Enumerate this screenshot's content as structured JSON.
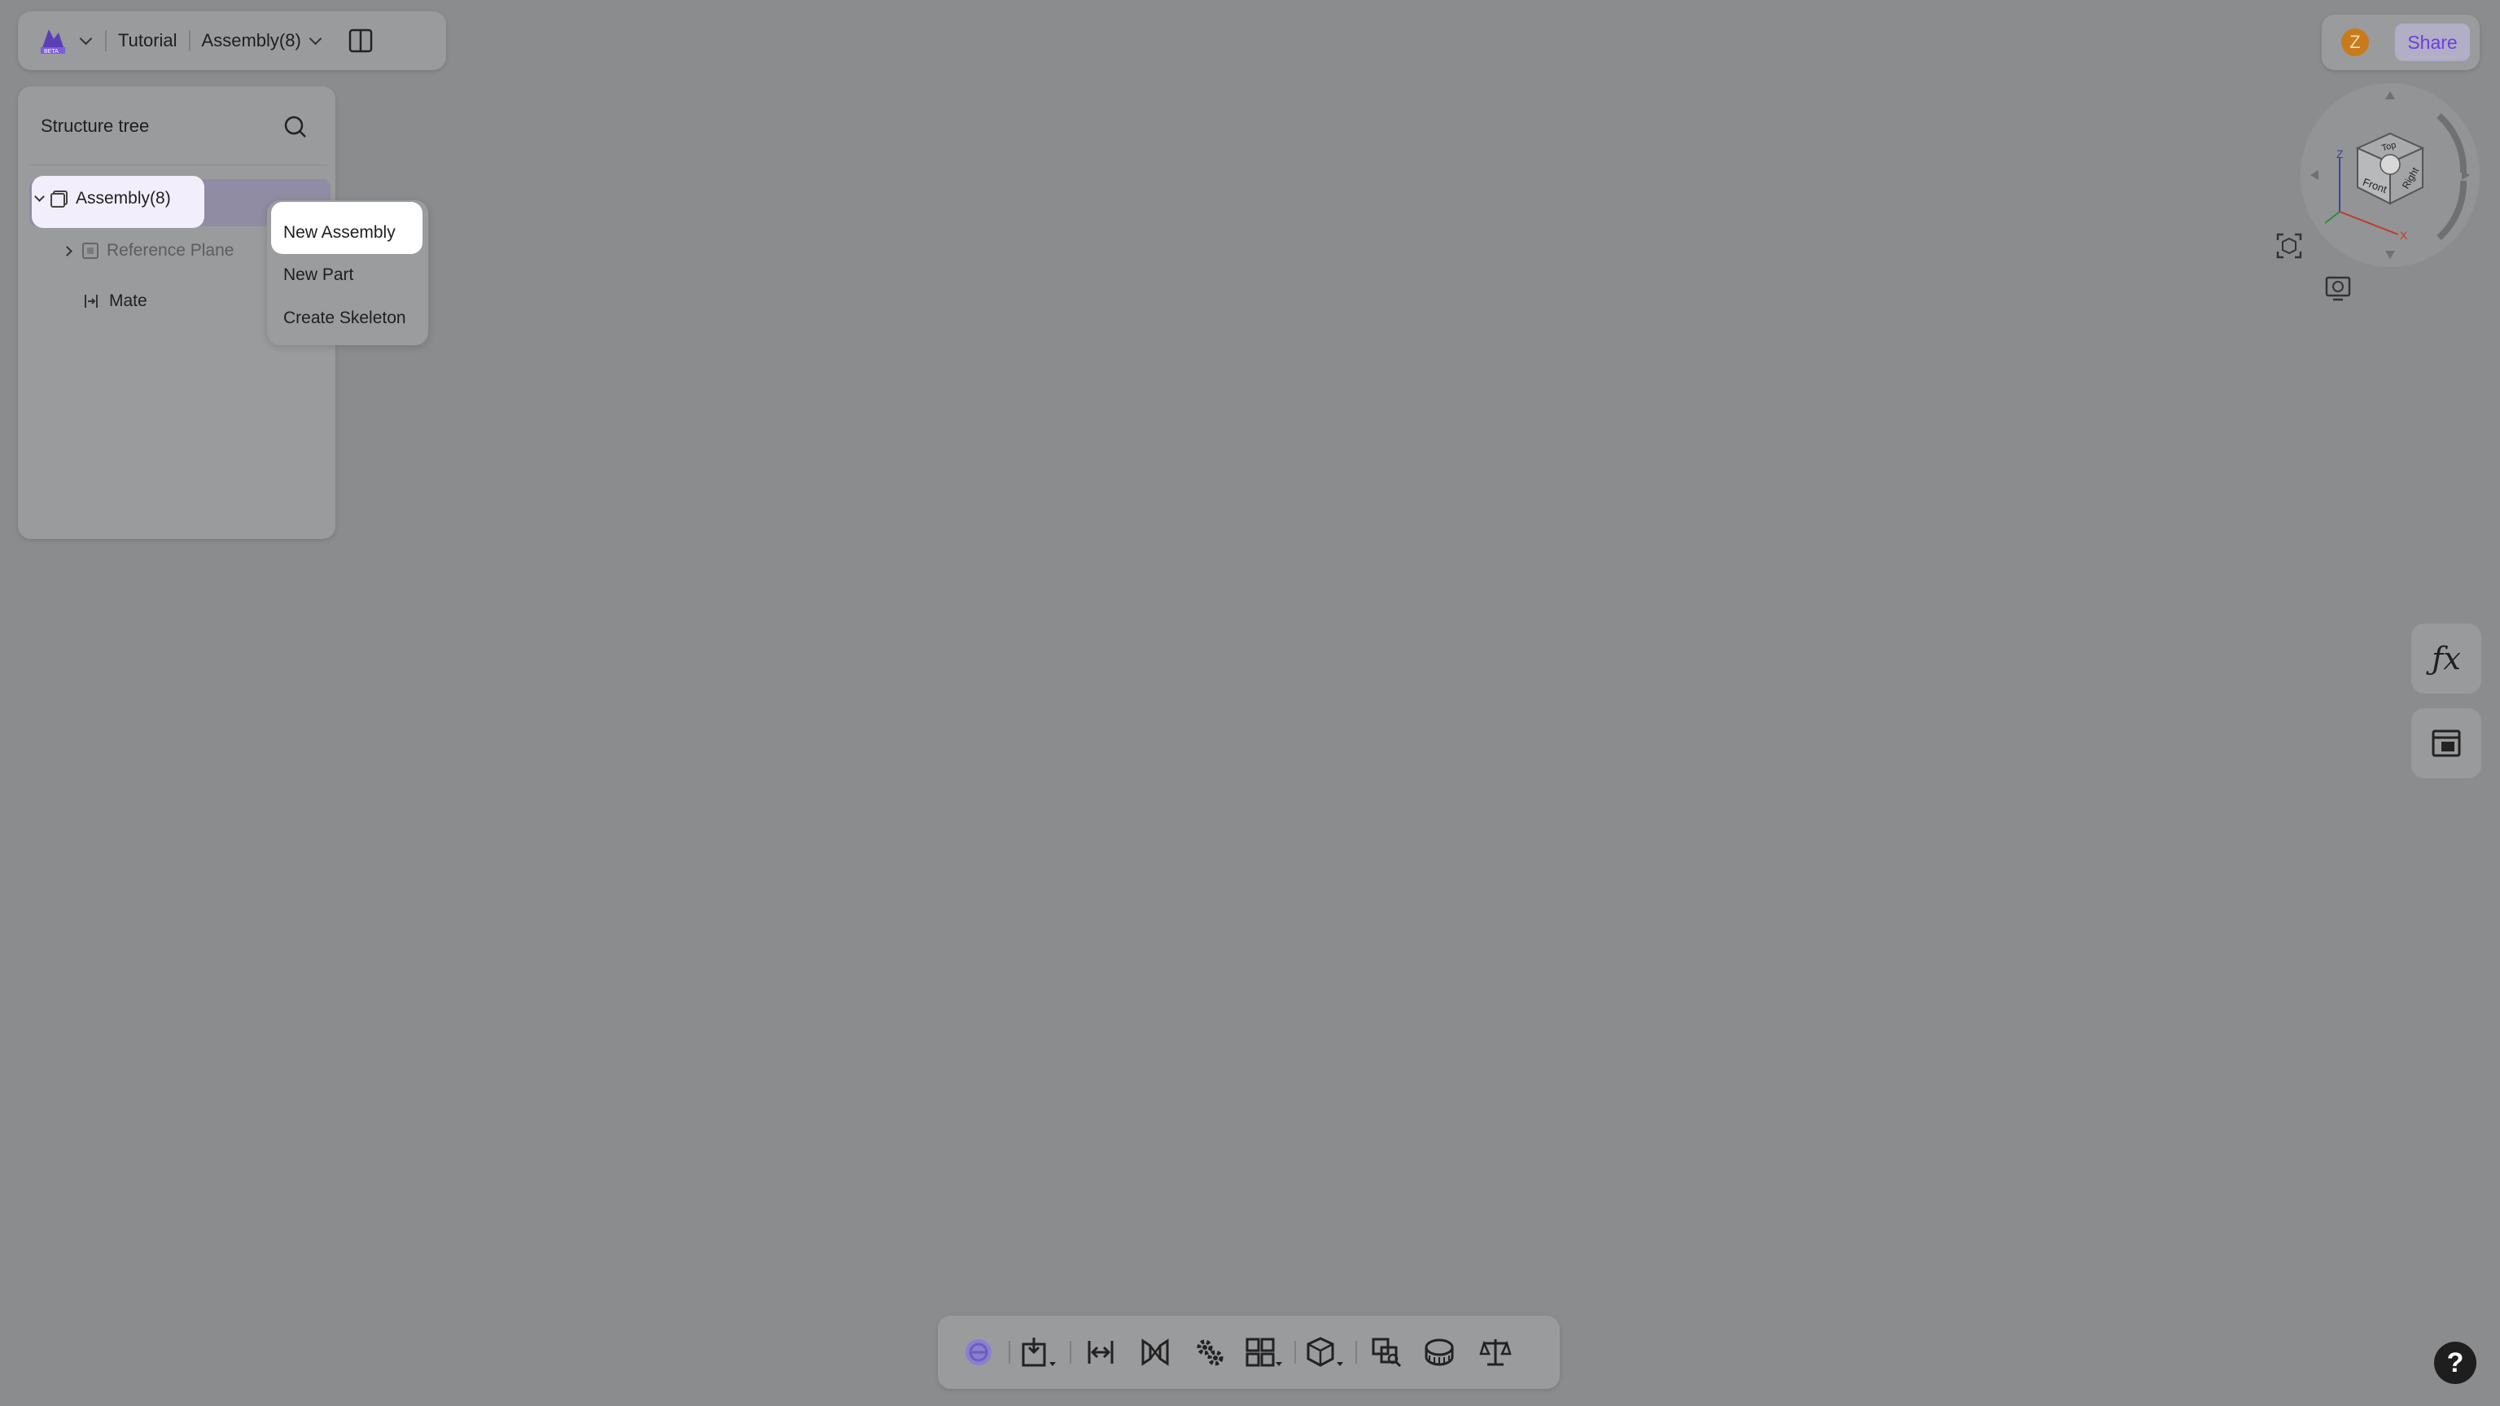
{
  "topbar": {
    "project": "Tutorial",
    "document": "Assembly(8)"
  },
  "tree": {
    "title": "Structure tree",
    "items": [
      {
        "label": "Assembly(8)"
      },
      {
        "label": "Reference Plane"
      },
      {
        "label": "Mate"
      }
    ]
  },
  "context_menu": {
    "items": [
      {
        "label": "New Assembly"
      },
      {
        "label": "New Part"
      },
      {
        "label": "Create Skeleton"
      }
    ]
  },
  "header_right": {
    "avatar_letter": "Z",
    "share_label": "Share"
  },
  "viewcube": {
    "faces": {
      "top": "Top",
      "front": "Front",
      "right": "Right"
    },
    "axes": {
      "z": "Z",
      "x": "X"
    }
  },
  "help_label": "?",
  "colors": {
    "accent": "#6a3fe0",
    "avatar": "#c87b1b",
    "overlay_bg": "#8b8c8e"
  }
}
